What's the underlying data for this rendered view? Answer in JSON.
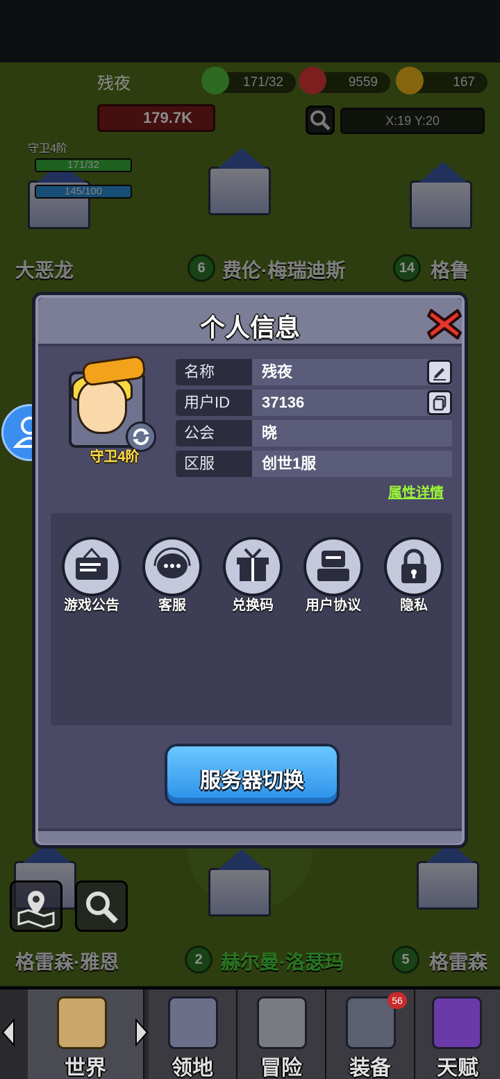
{
  "hud": {
    "player_name": "残夜",
    "power": "179.7K",
    "resources": [
      {
        "icon": "energy-plus-icon",
        "value": "171/32"
      },
      {
        "icon": "gem-plus-icon",
        "value": "9559"
      },
      {
        "icon": "coin-plus-icon",
        "value": "167"
      }
    ],
    "coords": "X:19   Y:20",
    "rank": "守卫4阶",
    "bars": [
      {
        "label": "171/32",
        "fill": 1.0,
        "color": "#35b03a"
      },
      {
        "label": "145/100",
        "fill": 1.0,
        "color": "#2a8fd6"
      }
    ]
  },
  "map": {
    "labels": [
      {
        "text": "大恶龙"
      },
      {
        "text": "费伦·梅瑞迪斯",
        "level": "6"
      },
      {
        "text": "格鲁",
        "level": "14"
      },
      {
        "text": "格雷森·雅恩"
      },
      {
        "text": "赫尔曼·洛瑟玛",
        "level": "2"
      },
      {
        "text": "格雷森",
        "level": "5"
      }
    ]
  },
  "modal": {
    "title": "个人信息",
    "rank_label": "守卫4阶",
    "info": [
      {
        "key": "名称",
        "value": "残夜",
        "action_icon": "edit-icon"
      },
      {
        "key": "用户ID",
        "value": "37136",
        "action_icon": "copy-icon"
      },
      {
        "key": "公会",
        "value": "晓"
      },
      {
        "key": "区服",
        "value": "创世1服"
      }
    ],
    "attr_link": "属性详情",
    "menu": [
      {
        "label": "游戏公告",
        "icon": "announcement-icon"
      },
      {
        "label": "客服",
        "icon": "customer-service-icon"
      },
      {
        "label": "兑换码",
        "icon": "gift-icon"
      },
      {
        "label": "用户协议",
        "icon": "agreement-icon"
      },
      {
        "label": "隐私",
        "icon": "lock-icon"
      }
    ],
    "server_button": "服务器切换"
  },
  "bottom_nav": [
    {
      "label": "世界",
      "icon": "world-map-icon"
    },
    {
      "label": "领地",
      "icon": "castle-icon"
    },
    {
      "label": "冒险",
      "icon": "crossed-axes-icon"
    },
    {
      "label": "装备",
      "icon": "helmet-icon",
      "badge": "56"
    },
    {
      "label": "天赋",
      "icon": "spellbook-icon"
    }
  ]
}
